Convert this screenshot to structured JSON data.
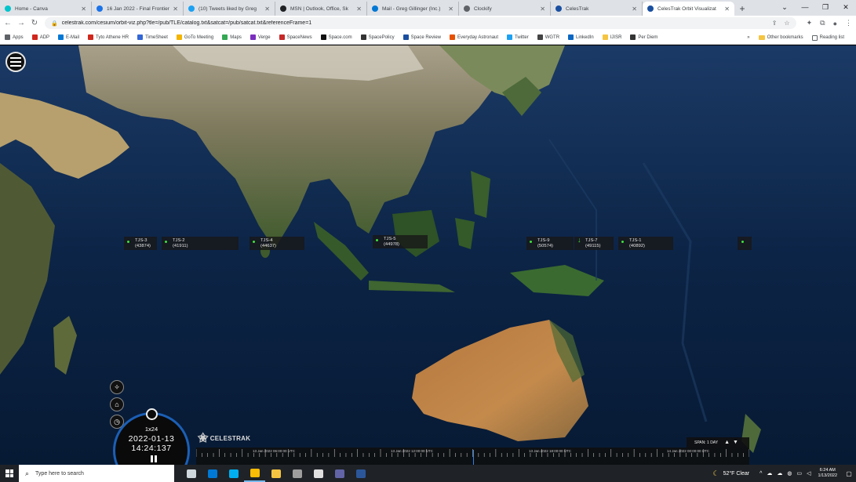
{
  "browser": {
    "tabs": [
      {
        "title": "Home - Canva",
        "color": "#00c4cc",
        "active": false
      },
      {
        "title": "16 Jan 2022 - Final Frontier",
        "color": "#1a73e8",
        "active": false
      },
      {
        "title": "(10) Tweets liked by Greg",
        "color": "#1da1f2",
        "active": false
      },
      {
        "title": "MSN | Outlook, Office, Sk",
        "color": "#202124",
        "active": false
      },
      {
        "title": "Mail - Greg Gillinger (Inc.)",
        "color": "#0078d4",
        "active": false
      },
      {
        "title": "Clockify",
        "color": "#5f6368",
        "active": false
      },
      {
        "title": "CelesTrak",
        "color": "#1a4fa0",
        "active": false
      },
      {
        "title": "CelesTrak Orbit Visualizat",
        "color": "#1a4fa0",
        "active": true
      }
    ],
    "new_tab": "+",
    "url": "celestrak.com/cesium/orbit-viz.php?tle=/pub/TLE/catalog.txt&satcat=/pub/satcat.txt&referenceFrame=1",
    "bookmarks": [
      {
        "label": "Apps",
        "color": "#5f6368"
      },
      {
        "label": "ADP",
        "color": "#d0271d"
      },
      {
        "label": "E-Mail",
        "color": "#0078d4"
      },
      {
        "label": "Tyto Athene HR",
        "color": "#d0271d"
      },
      {
        "label": "TimeSheet",
        "color": "#3367d6"
      },
      {
        "label": "GoTo Meeting",
        "color": "#f4b400"
      },
      {
        "label": "Maps",
        "color": "#34a853"
      },
      {
        "label": "Verge",
        "color": "#7b2fbf"
      },
      {
        "label": "SpaceNews",
        "color": "#c62828"
      },
      {
        "label": "Space.com",
        "color": "#111111"
      },
      {
        "label": "SpacePolicy",
        "color": "#333333"
      },
      {
        "label": "Space Review",
        "color": "#1a4fa0"
      },
      {
        "label": "Everyday Astronaut",
        "color": "#e65100"
      },
      {
        "label": "Twitter",
        "color": "#1da1f2"
      },
      {
        "label": "WGTR",
        "color": "#444444"
      },
      {
        "label": "LinkedIn",
        "color": "#0a66c2"
      },
      {
        "label": "IJISR",
        "color": "#f5c542"
      },
      {
        "label": "Per Diem",
        "color": "#333333"
      }
    ],
    "bookmarks_more": "»",
    "other_bookmarks": "Other bookmarks",
    "reading_list": "Reading list"
  },
  "satellites": [
    {
      "name": "TJS-3",
      "id": "(43874)"
    },
    {
      "name": "TJS-2",
      "id": "(41911)"
    },
    {
      "name": "TJS-4",
      "id": "(44637)"
    },
    {
      "name": "TJS-5",
      "id": "(44978)"
    },
    {
      "name": "TJS-9",
      "id": "(50574)"
    },
    {
      "name": "TJS-7",
      "id": "(49115)"
    },
    {
      "name": "TJS-1",
      "id": "(40892)"
    }
  ],
  "clock": {
    "speed": "1x24",
    "date": "2022-01-13",
    "time": "14:24:137"
  },
  "logo": "CELESTRAK",
  "timeline": {
    "labels": [
      "13 Jan 2022 06:00:00 UTC",
      "13 Jan 2022 12:00:00 UTC",
      "13 Jan 2022 18:00:00 UTC",
      "14 Jan 2022 00:00:00 UTC"
    ],
    "cursor_fraction": 0.5
  },
  "span": {
    "label": "SPAN: 1 DAY"
  },
  "taskbar": {
    "search_placeholder": "Type here to search",
    "apps": [
      {
        "name": "task-view",
        "color": "#cfd8dc"
      },
      {
        "name": "outlook",
        "color": "#0078d4"
      },
      {
        "name": "skype",
        "color": "#00aff0"
      },
      {
        "name": "chrome",
        "color": "#fbbc05"
      },
      {
        "name": "file-explorer",
        "color": "#f5c542"
      },
      {
        "name": "app-circle",
        "color": "#9e9e9e"
      },
      {
        "name": "calculator",
        "color": "#e0e0e0"
      },
      {
        "name": "teams",
        "color": "#6264a7"
      },
      {
        "name": "word",
        "color": "#2b579a"
      }
    ],
    "weather": "52°F Clear",
    "time": "6:24 AM",
    "date": "1/13/2022"
  }
}
